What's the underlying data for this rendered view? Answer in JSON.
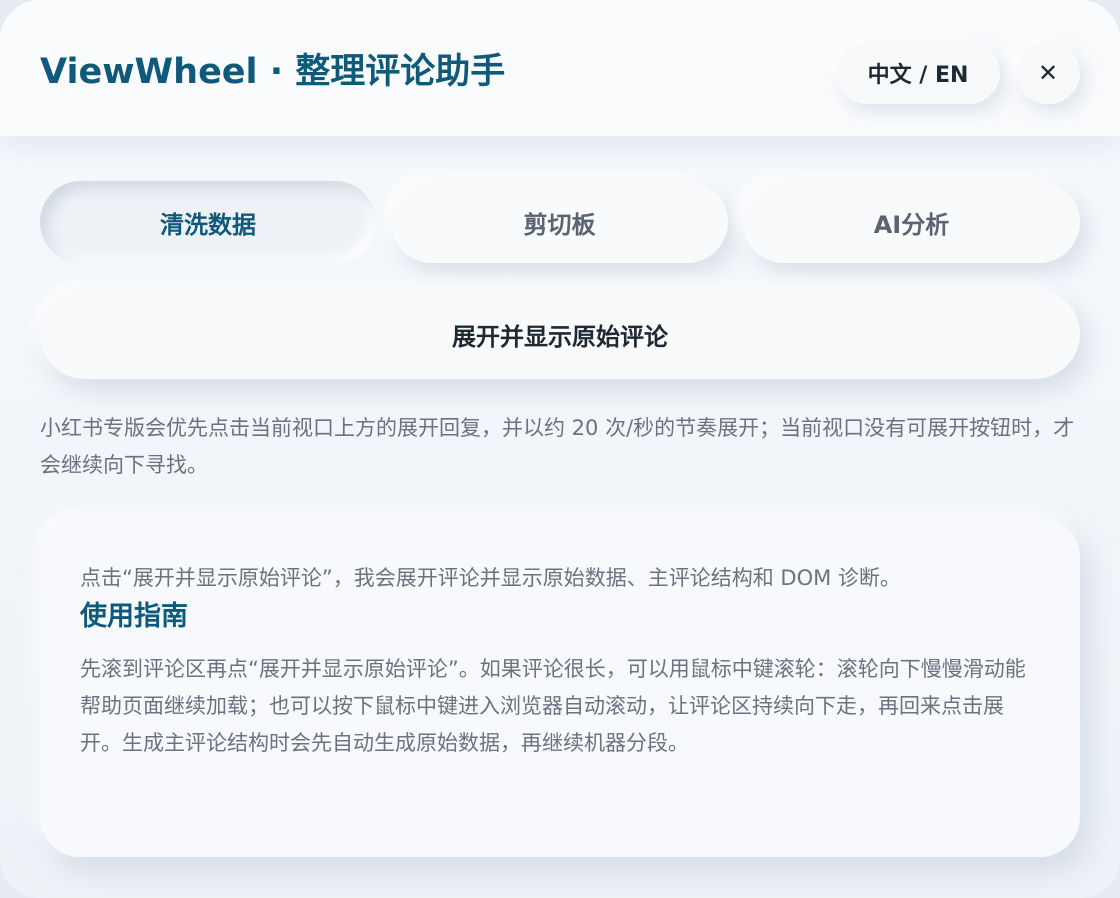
{
  "header": {
    "title": "ViewWheel · 整理评论助手",
    "lang_toggle": "中文 / EN",
    "close_symbol": "✕"
  },
  "tabs": [
    {
      "label": "清洗数据",
      "active": true
    },
    {
      "label": "剪切板",
      "active": false
    },
    {
      "label": "AI分析",
      "active": false
    }
  ],
  "main_action": {
    "label": "展开并显示原始评论"
  },
  "description": "小红书专版会优先点击当前视口上方的展开回复，并以约 20 次/秒的节奏展开；当前视口没有可展开按钮时，才会继续向下寻找。",
  "guide": {
    "intro": "点击“展开并显示原始评论”，我会展开评论并显示原始数据、主评论结构和 DOM 诊断。",
    "title": "使用指南",
    "body": "先滚到评论区再点“展开并显示原始评论”。如果评论很长，可以用鼠标中键滚轮：滚轮向下慢慢滑动能帮助页面继续加载；也可以按下鼠标中键进入浏览器自动滚动，让评论区持续向下走，再回来点击展开。生成主评论结构时会先自动生成原始数据，再继续机器分段。"
  },
  "colors": {
    "accent": "#0f5a7a",
    "text_primary": "#1f2933",
    "text_muted": "#6b7280",
    "surface": "#f7f9fc"
  }
}
